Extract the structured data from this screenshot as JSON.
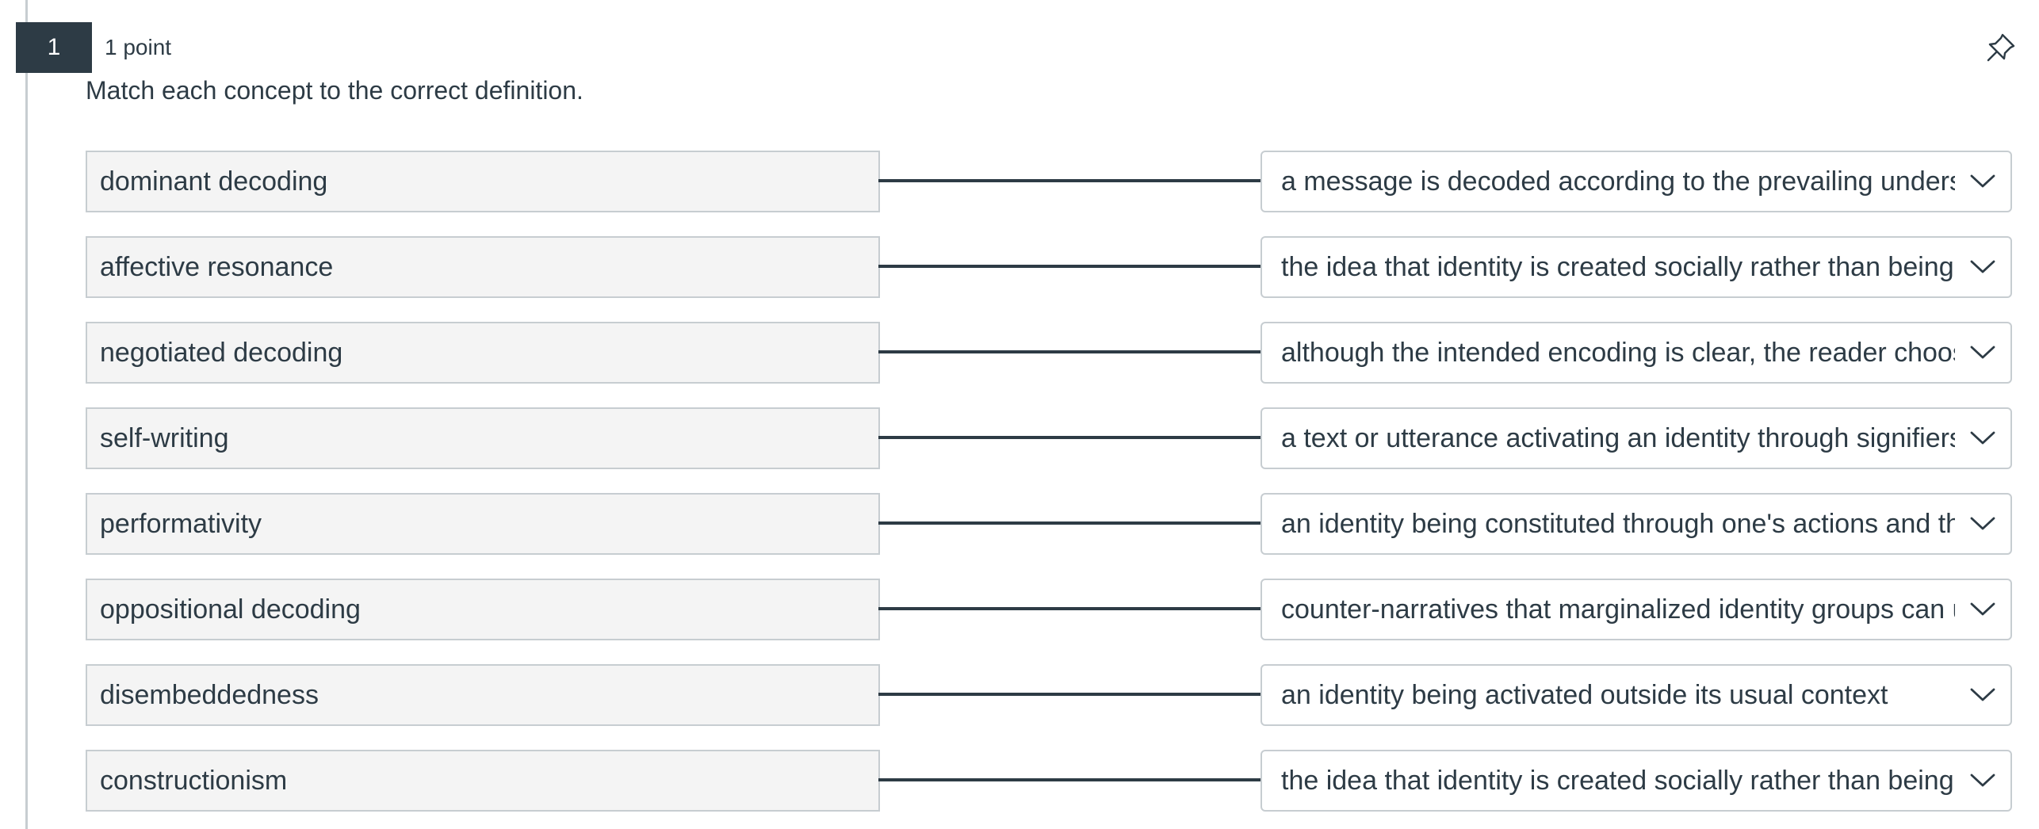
{
  "question": {
    "number": "1",
    "points": "1 point",
    "prompt": "Match each concept to the correct definition."
  },
  "rows": [
    {
      "concept": "dominant decoding",
      "answer": "a message is decoded according to the prevailing understanding"
    },
    {
      "concept": "affective resonance",
      "answer": "the idea that identity is created socially rather than being innate"
    },
    {
      "concept": "negotiated decoding",
      "answer": "although the intended encoding is clear, the reader chooses n"
    },
    {
      "concept": "self-writing",
      "answer": "a text or utterance activating an identity through signifiers of"
    },
    {
      "concept": "performativity",
      "answer": "an identity being constituted through one's actions and the ac"
    },
    {
      "concept": "oppositional decoding",
      "answer": "counter-narratives that marginalized identity groups can use"
    },
    {
      "concept": "disembeddedness",
      "answer": "an identity being activated outside its usual context"
    },
    {
      "concept": "constructionism",
      "answer": "the idea that identity is created socially rather than being innate"
    }
  ],
  "icons": {
    "pin": "pin-icon",
    "dropdown": "chevron-down-icon"
  },
  "colors": {
    "text": "#2d3b45",
    "badge": "#2d3b45",
    "border": "#c7cdd1",
    "concept_bg": "#f4f4f4"
  }
}
